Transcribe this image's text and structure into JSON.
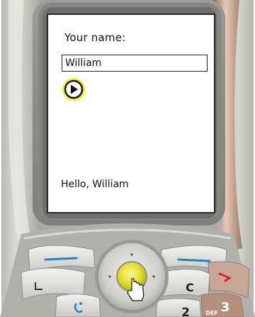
{
  "screen": {
    "prompt_label": "Your name:",
    "name_value": "William",
    "submit_icon": "play-icon",
    "greeting_text": "Hello, William"
  },
  "keypad": {
    "clear_key_label": "C",
    "key_2_label": "2",
    "key_3_label": "3",
    "key_3_letters": "DEF"
  },
  "colors": {
    "accent_yellow": "#f2ee2a",
    "softkey_blue": "#1e86c4",
    "end_call_red": "#d8262b",
    "bezel_copper": "#b88a6e"
  }
}
